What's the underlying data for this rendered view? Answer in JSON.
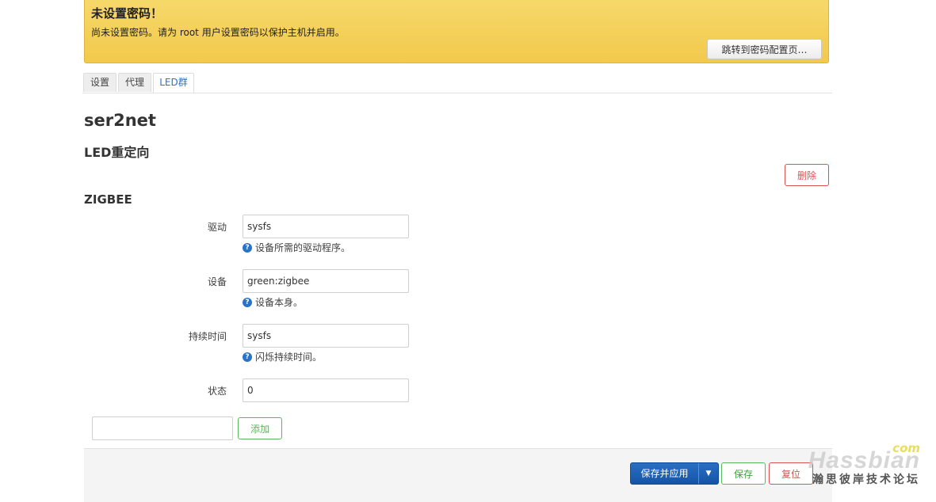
{
  "alert": {
    "title": "未设置密码！",
    "text": "尚未设置密码。请为 root 用户设置密码以保护主机并启用。",
    "button": "跳转到密码配置页…"
  },
  "tabs": [
    {
      "label": "设置",
      "active": false
    },
    {
      "label": "代理",
      "active": false
    },
    {
      "label": "LED群",
      "active": true
    }
  ],
  "page_title": "ser2net",
  "section_title": "LED重定向",
  "delete_button": "删除",
  "subsection_title": "ZIGBEE",
  "fields": [
    {
      "label": "驱动",
      "value": "sysfs",
      "help": "设备所需的驱动程序。"
    },
    {
      "label": "设备",
      "value": "green:zigbee",
      "help": "设备本身。"
    },
    {
      "label": "持续时间",
      "value": "sysfs",
      "help": "闪烁持续时间。"
    },
    {
      "label": "状态",
      "value": "0",
      "help": ""
    }
  ],
  "add": {
    "value": "",
    "button": "添加"
  },
  "footer": {
    "save_apply": "保存并应用",
    "save": "保存",
    "reset": "复位"
  },
  "watermark": {
    "com": "com",
    "main": "Hassbian",
    "sub": "瀚思彼岸技术论坛"
  },
  "colors": {
    "alert_bg": "#f2c94b",
    "primary": "#1555a8",
    "danger": "#d9534f",
    "success": "#5cb85c",
    "tab_active": "#2a74c7"
  }
}
